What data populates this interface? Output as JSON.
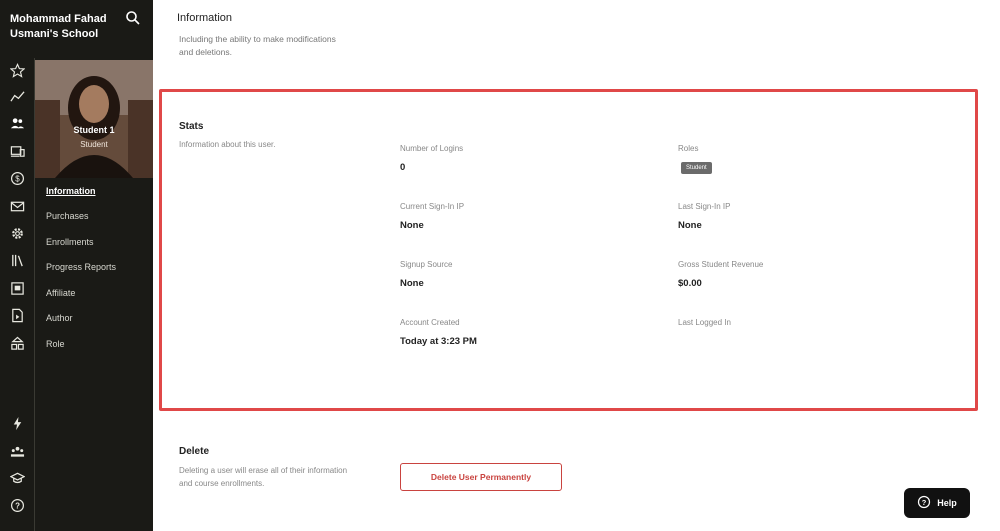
{
  "sidebar": {
    "school_name": "Mohammad Fahad Usmani's School",
    "icons": [
      "star-icon",
      "trending-icon",
      "users-icon",
      "devices-icon",
      "dollar-icon",
      "mail-icon",
      "gear-icon",
      "library-icon",
      "report-icon",
      "document-icon",
      "org-chart-icon",
      "lightning-icon",
      "community-icon",
      "graduation-icon",
      "help-icon"
    ]
  },
  "profile": {
    "name": "Student 1",
    "role": "Student"
  },
  "nav": {
    "items": [
      "Information",
      "Purchases",
      "Enrollments",
      "Progress Reports",
      "Affiliate",
      "Author",
      "Role"
    ],
    "active": "Information"
  },
  "top_section": {
    "title": "Information",
    "description": "Including the ability to make modifications and deletions."
  },
  "stats": {
    "title": "Stats",
    "description": "Information about this user.",
    "fields": [
      {
        "label": "Number of Logins",
        "value": "0"
      },
      {
        "label": "Roles",
        "value": "Student"
      },
      {
        "label": "Current Sign-In IP",
        "value": "None"
      },
      {
        "label": "Last Sign-In IP",
        "value": "None"
      },
      {
        "label": "Signup Source",
        "value": "None"
      },
      {
        "label": "Gross Student Revenue",
        "value": "$0.00"
      },
      {
        "label": "Account Created",
        "value": "Today at 3:23 PM"
      },
      {
        "label": "Last Logged In",
        "value": ""
      }
    ]
  },
  "delete": {
    "title": "Delete",
    "description": "Deleting a user will erase all of their information and course enrollments.",
    "button_label": "Delete User Permanently"
  },
  "help": {
    "label": "Help"
  },
  "colors": {
    "sidebar_bg": "#1a1a16",
    "highlight_border": "#e04848",
    "danger": "#c9433f",
    "badge_bg": "#6b6b6b"
  }
}
